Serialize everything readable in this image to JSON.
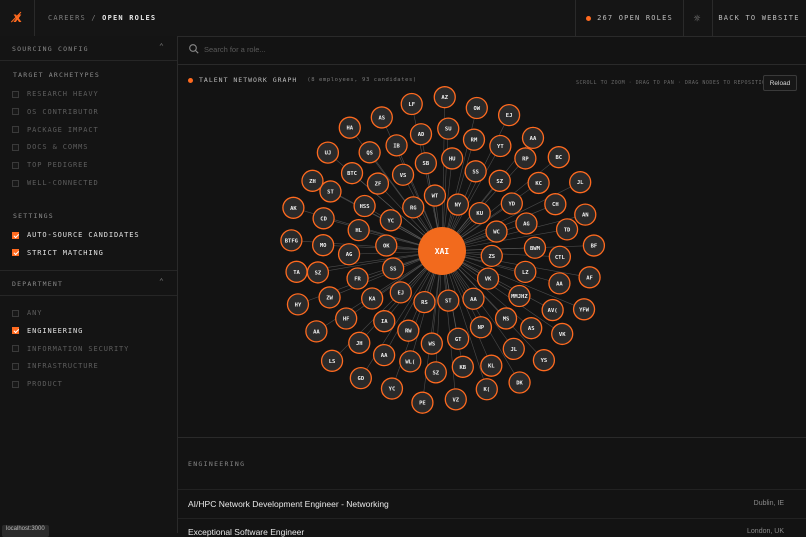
{
  "header": {
    "logo": "x̸",
    "breadcrumb_parent": "CAREERS",
    "breadcrumb_sep": "/",
    "breadcrumb_current": "OPEN ROLES",
    "open_roles": "267 OPEN ROLES",
    "back_label": "BACK TO WEBSITE",
    "accent": "#ff6a1f"
  },
  "sidebar": {
    "sourcing_title": "SOURCING CONFIG",
    "archetypes_label": "TARGET ARCHETYPES",
    "archetypes": [
      {
        "label": "RESEARCH HEAVY",
        "checked": false
      },
      {
        "label": "OS CONTRIBUTOR",
        "checked": false
      },
      {
        "label": "PACKAGE IMPACT",
        "checked": false
      },
      {
        "label": "DOCS & COMMS",
        "checked": false
      },
      {
        "label": "TOP PEDIGREE",
        "checked": false
      },
      {
        "label": "WELL-CONNECTED",
        "checked": false
      }
    ],
    "settings_label": "SETTINGS",
    "settings": [
      {
        "label": "AUTO-SOURCE CANDIDATES",
        "checked": true
      },
      {
        "label": "STRICT MATCHING",
        "checked": true
      }
    ],
    "department_title": "DEPARTMENT",
    "departments": [
      {
        "label": "ANY",
        "checked": false
      },
      {
        "label": "ENGINEERING",
        "checked": true
      },
      {
        "label": "INFORMATION SECURITY",
        "checked": false
      },
      {
        "label": "INFRASTRUCTURE",
        "checked": false
      },
      {
        "label": "PRODUCT",
        "checked": false
      }
    ]
  },
  "search": {
    "placeholder": "Search for a role..."
  },
  "graph": {
    "title": "TALENT NETWORK GRAPH",
    "subtitle": "(8 employees, 93 candidates)",
    "hint": "SCROLL TO ZOOM · DRAG TO PAN · DRAG NODES TO REPOSITION",
    "reload": "Reload",
    "center": "XAI",
    "nodes": [
      "ZS",
      "VK",
      "AA",
      "ST",
      "RS",
      "EJ",
      "SS",
      "OK",
      "YC",
      "RG",
      "WT",
      "NY",
      "KU",
      "WC",
      "LZ",
      "MMJHZ",
      "MS",
      "NP",
      "GT",
      "WS",
      "RW",
      "IA",
      "KA",
      "FR",
      "AG",
      "HL",
      "HSS",
      "ZF",
      "VS",
      "SB",
      "HU",
      "SS",
      "SZ",
      "YD",
      "AG",
      "BWM",
      "CTL",
      "AA",
      "AV(",
      "AS",
      "JL",
      "KL",
      "KB",
      "SZ",
      "WL(",
      "AA",
      "JH",
      "HF",
      "ZW",
      "SZ",
      "MO",
      "CD",
      "ST",
      "BTC",
      "QS",
      "IB",
      "AD",
      "SU",
      "RM",
      "YT",
      "RP",
      "KC",
      "CH",
      "TD",
      "AF",
      "YFW",
      "VK",
      "YS",
      "DK",
      "K(",
      "VZ",
      "PE",
      "YC",
      "GD",
      "LS",
      "AA",
      "HY",
      "TA",
      "BTFG",
      "AK",
      "ZH",
      "UJ",
      "HA",
      "AS",
      "LF",
      "AZ",
      "OW",
      "EJ",
      "AA",
      "BC",
      "JL",
      "AN",
      "BF"
    ]
  },
  "jobs": {
    "department": "ENGINEERING",
    "items": [
      {
        "title": "AI/HPC Network Development Engineer - Networking",
        "location": "Dublin, IE"
      },
      {
        "title": "Exceptional Software Engineer",
        "location": "London, UK"
      }
    ]
  },
  "status": {
    "text": "localhost:3000"
  }
}
